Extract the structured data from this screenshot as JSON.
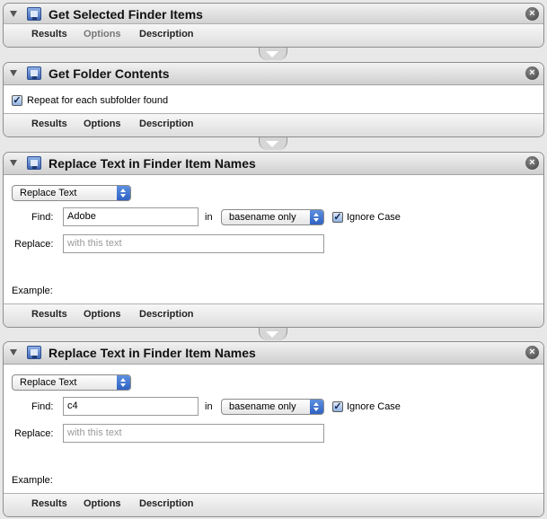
{
  "actions": [
    {
      "title": "Get Selected Finder Items",
      "tabs": {
        "results": "Results",
        "options": "Options",
        "description": "Description"
      },
      "options_dimmed": true
    },
    {
      "title": "Get Folder Contents",
      "checkbox_label": "Repeat for each subfolder found",
      "checkbox_checked": true,
      "tabs": {
        "results": "Results",
        "options": "Options",
        "description": "Description"
      }
    },
    {
      "title": "Replace Text in Finder Item Names",
      "mode_popup": "Replace Text",
      "find_label": "Find:",
      "find_value": "Adobe",
      "in_label": "in",
      "scope_popup": "basename only",
      "ignore_case_label": "Ignore Case",
      "ignore_case_checked": true,
      "replace_label": "Replace:",
      "replace_placeholder": "with this text",
      "example_label": "Example:",
      "tabs": {
        "results": "Results",
        "options": "Options",
        "description": "Description"
      }
    },
    {
      "title": "Replace Text in Finder Item Names",
      "mode_popup": "Replace Text",
      "find_label": "Find:",
      "find_value": "c4",
      "in_label": "in",
      "scope_popup": "basename only",
      "ignore_case_label": "Ignore Case",
      "ignore_case_checked": true,
      "replace_label": "Replace:",
      "replace_placeholder": "with this text",
      "example_label": "Example:",
      "tabs": {
        "results": "Results",
        "options": "Options",
        "description": "Description"
      }
    }
  ],
  "icons": {
    "disclosure": "disclosure-triangle-icon",
    "app": "finder-app-icon",
    "close": "close-icon",
    "check": "✓",
    "close_glyph": "×"
  }
}
